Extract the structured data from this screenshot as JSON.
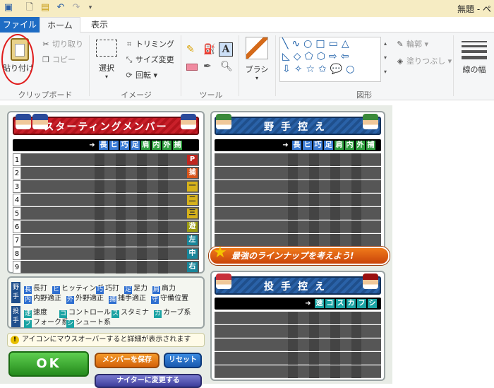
{
  "window": {
    "title": "無題 - ペイント"
  },
  "tabs": {
    "file": "ファイル",
    "home": "ホーム",
    "view": "表示"
  },
  "ribbon": {
    "clipboard": {
      "paste": "貼り付け",
      "cut": "切り取り",
      "copy": "コピー",
      "label": "クリップボード"
    },
    "image": {
      "select": "選択",
      "crop": "トリミング",
      "resize": "サイズ変更",
      "rotate": "回転",
      "label": "イメージ"
    },
    "tools": {
      "label": "ツール"
    },
    "brush": {
      "label": "ブラシ"
    },
    "shapes": {
      "outline": "輪郭",
      "fill": "塗りつぶし",
      "label": "図形"
    },
    "size": {
      "label": "線の幅"
    }
  },
  "game": {
    "starting": {
      "title": "スターティングメンバー",
      "stats": [
        "長",
        "ヒ",
        "巧",
        "足",
        "肩",
        "内",
        "外",
        "捕"
      ],
      "rows": [
        {
          "num": "1",
          "pos": "P",
          "color": "red"
        },
        {
          "num": "2",
          "pos": "捕",
          "color": "orange"
        },
        {
          "num": "3",
          "pos": "一",
          "color": "yellow"
        },
        {
          "num": "4",
          "pos": "二",
          "color": "yellow"
        },
        {
          "num": "5",
          "pos": "三",
          "color": "yellow"
        },
        {
          "num": "6",
          "pos": "遊",
          "color": "olive"
        },
        {
          "num": "7",
          "pos": "左",
          "color": "teal"
        },
        {
          "num": "8",
          "pos": "中",
          "color": "teal"
        },
        {
          "num": "9",
          "pos": "右",
          "color": "teal"
        }
      ]
    },
    "fielders_bench": {
      "title": "野手控え",
      "stats": [
        "長",
        "ヒ",
        "巧",
        "足",
        "肩",
        "内",
        "外",
        "捕"
      ]
    },
    "pitchers_bench": {
      "title": "投手控え",
      "stats": [
        "速",
        "コ",
        "ス",
        "カ",
        "フ",
        "シ"
      ]
    },
    "banner": "最強のラインナップを考えよう!",
    "legend": {
      "fielder_label": "野手",
      "pitcher_label": "投手",
      "fielder_items": [
        {
          "icon": "長",
          "text": "長打"
        },
        {
          "icon": "ヒ",
          "text": "ヒッティング"
        },
        {
          "icon": "巧",
          "text": "巧打"
        },
        {
          "icon": "足",
          "text": "足力"
        },
        {
          "icon": "肩",
          "text": "肩力"
        },
        {
          "icon": "内",
          "text": "内野適正"
        },
        {
          "icon": "外",
          "text": "外野適正"
        },
        {
          "icon": "捕",
          "text": "捕手適正"
        },
        {
          "icon": "守",
          "text": "守備位置"
        }
      ],
      "pitcher_items": [
        {
          "icon": "速",
          "text": "速度"
        },
        {
          "icon": "コ",
          "text": "コントロール"
        },
        {
          "icon": "ス",
          "text": "スタミナ"
        },
        {
          "icon": "カ",
          "text": "カーブ系"
        },
        {
          "icon": "フ",
          "text": "フォーク系"
        },
        {
          "icon": "シ",
          "text": "シュート系"
        }
      ]
    },
    "notice": "アイコンにマウスオーバーすると詳細が表示されます",
    "buttons": {
      "ok": "OK",
      "save": "メンバーを保存",
      "reset": "リセット",
      "nighter": "ナイターに変更する"
    }
  }
}
